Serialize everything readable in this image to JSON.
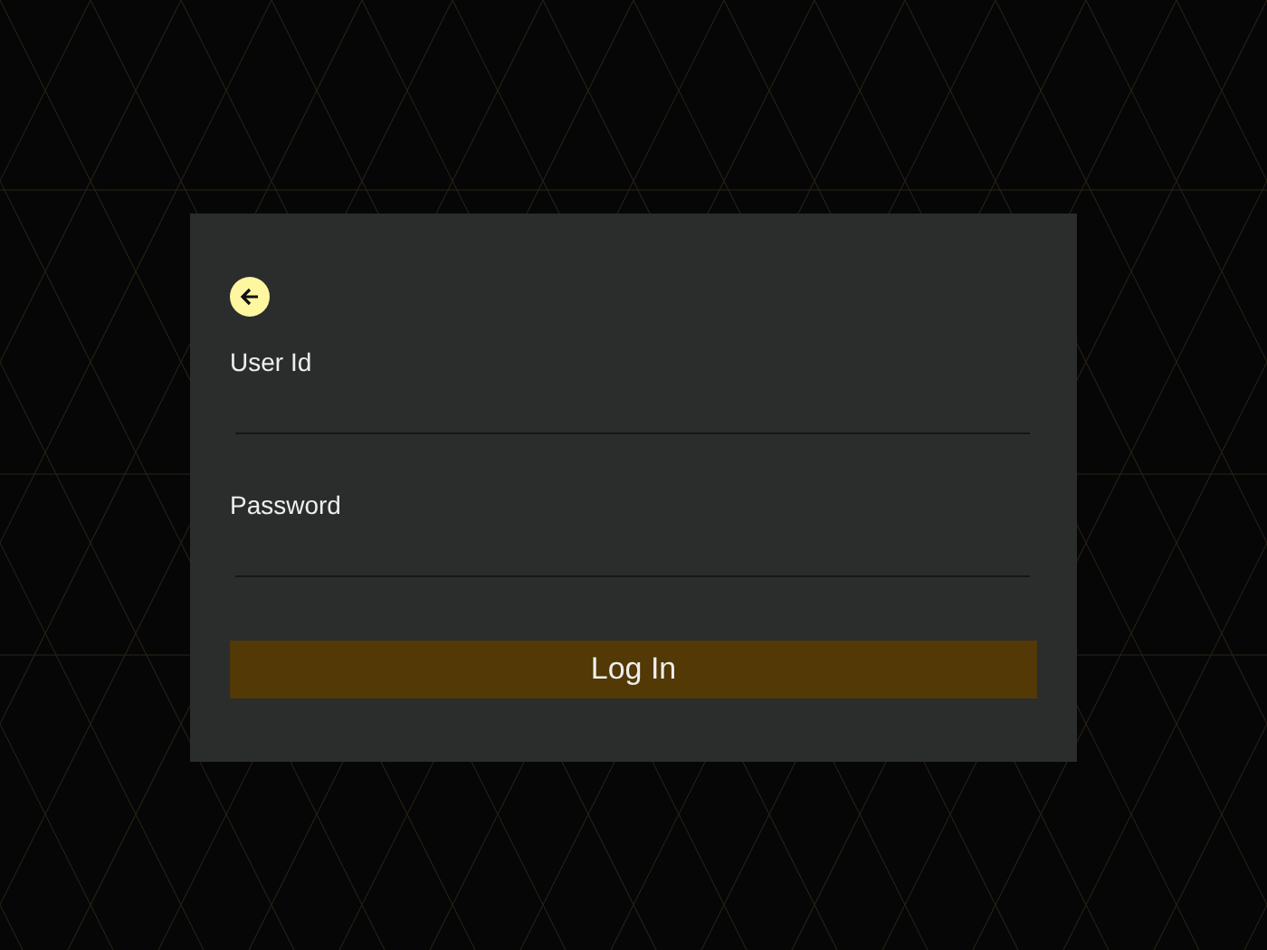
{
  "login_form": {
    "fields": [
      {
        "label": "User Id"
      },
      {
        "label": "Password"
      }
    ],
    "submit_button": "Log In"
  }
}
